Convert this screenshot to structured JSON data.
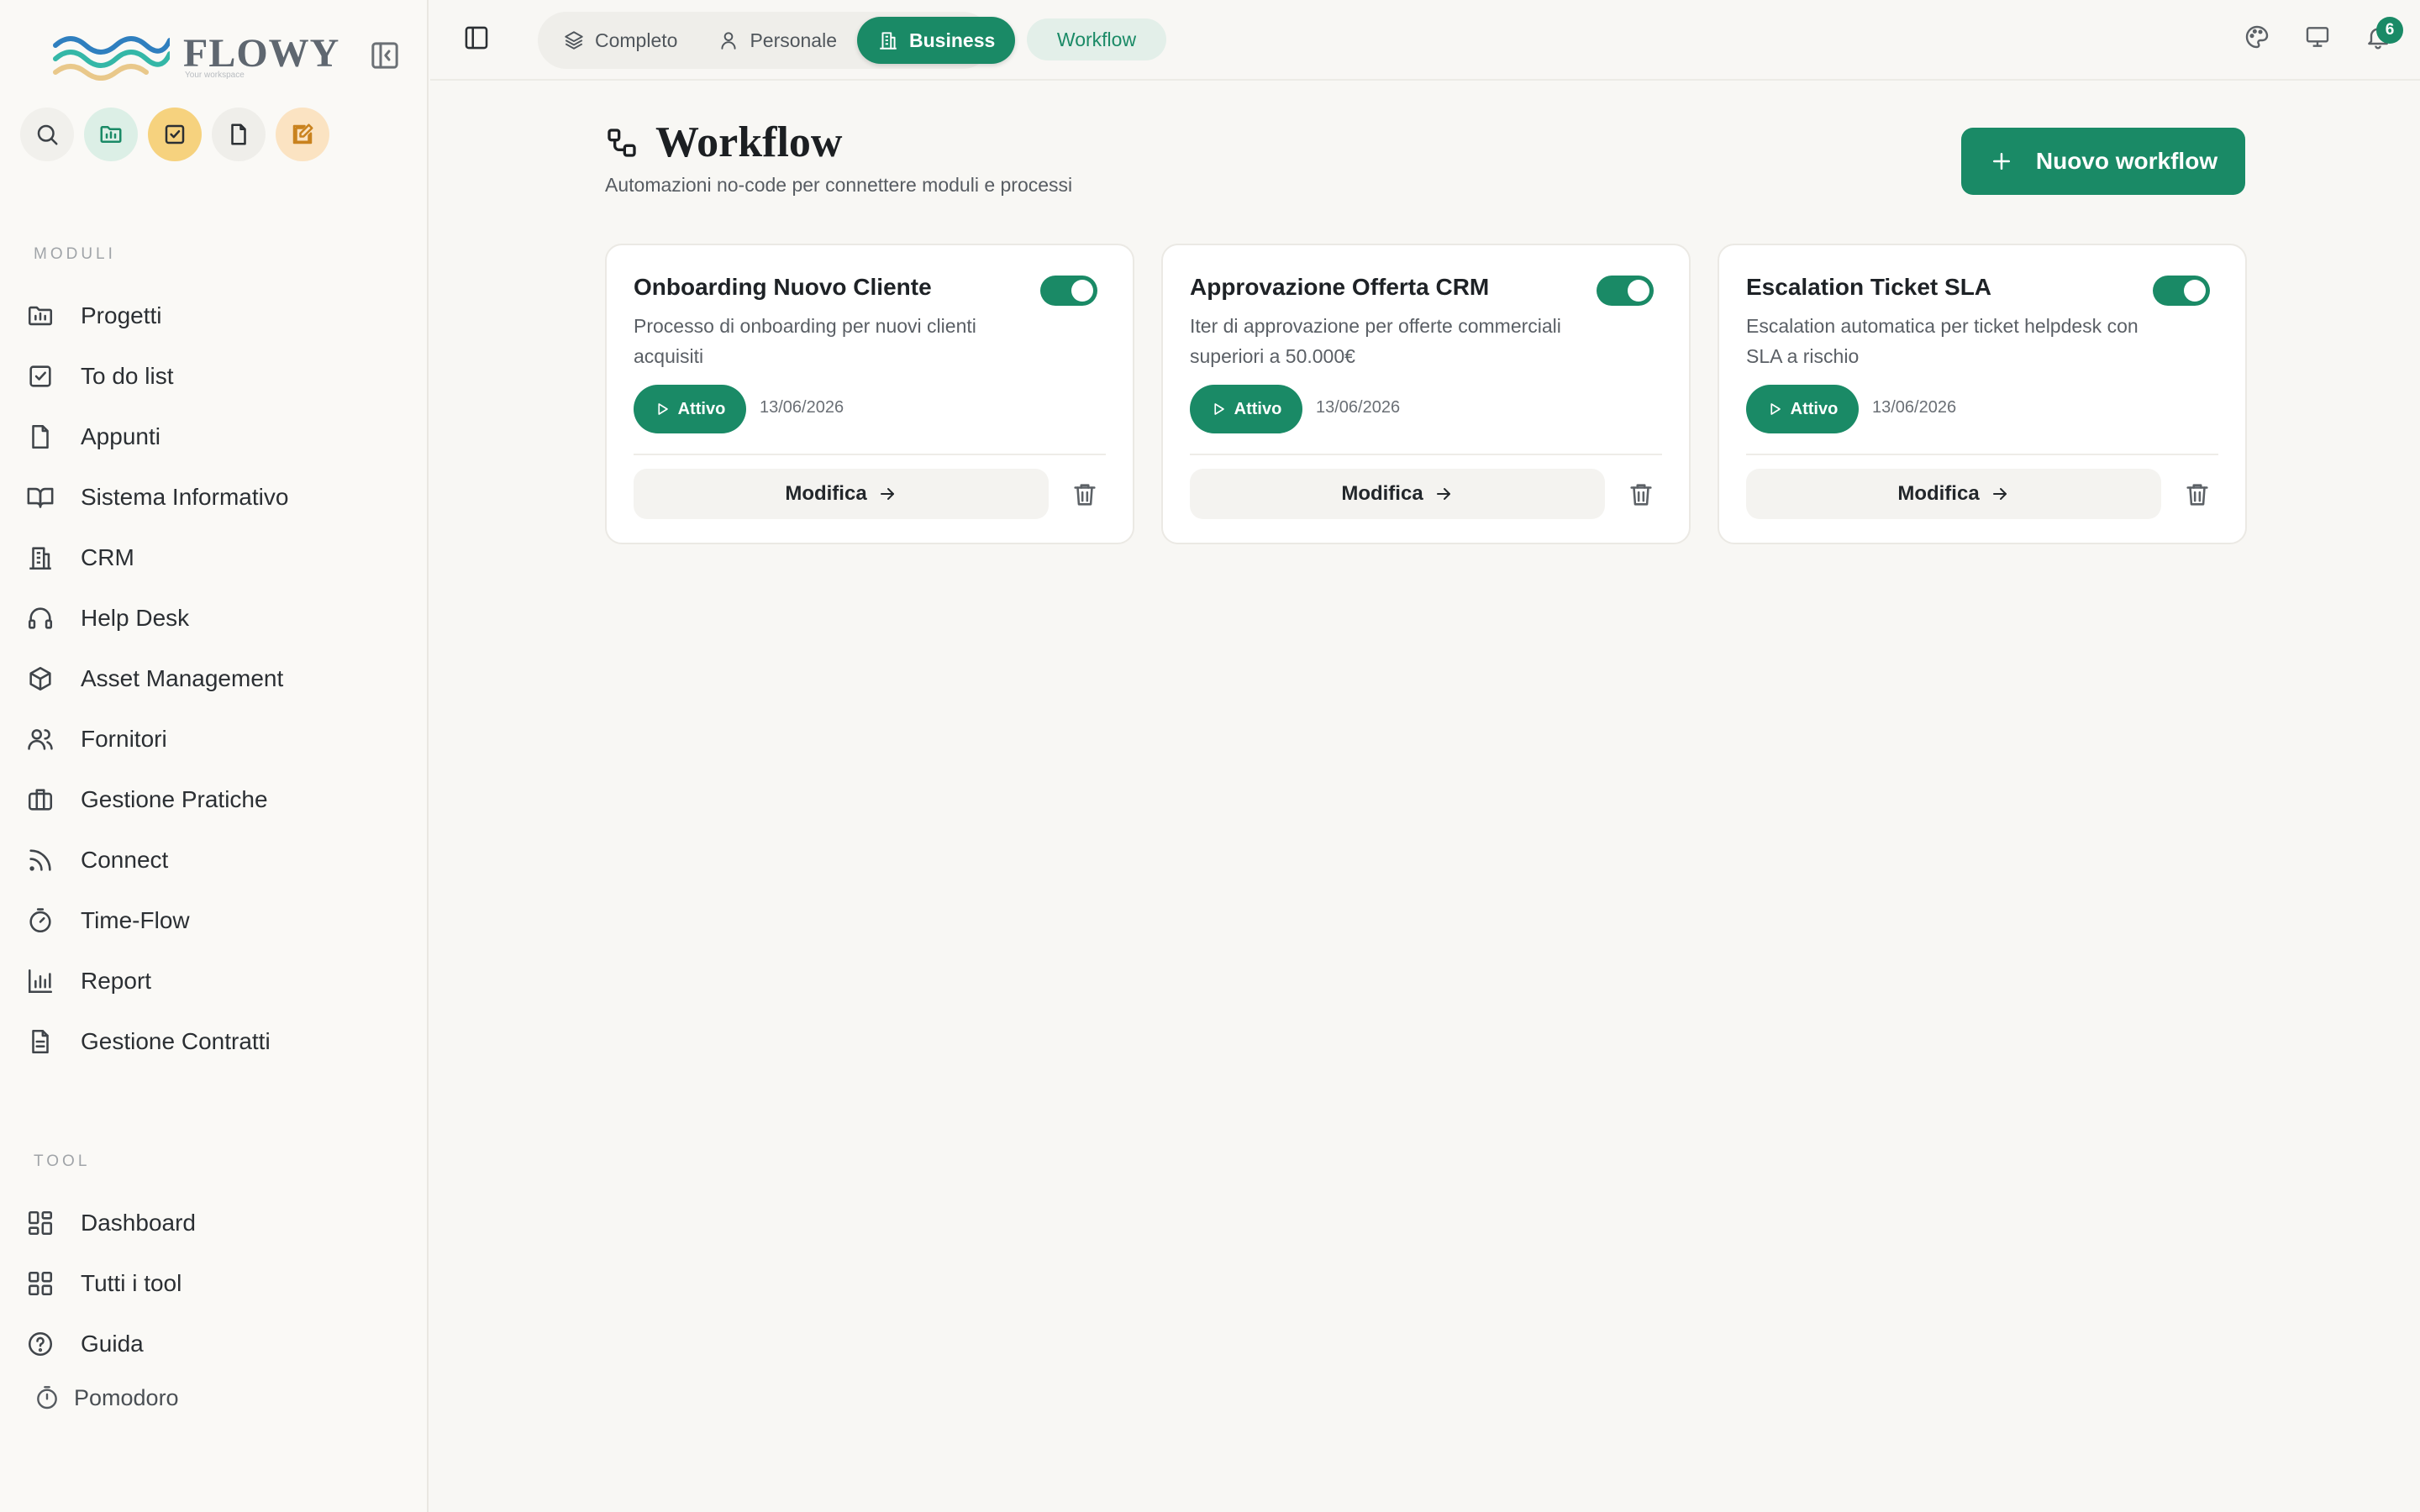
{
  "app": {
    "logo_text": "FLOWY",
    "logo_sub": "Your workspace"
  },
  "sidebar": {
    "section_modules": "MODULI",
    "modules": [
      {
        "label": "Progetti",
        "icon": "folder-chart-icon"
      },
      {
        "label": "To do list",
        "icon": "checkbox-icon"
      },
      {
        "label": "Appunti",
        "icon": "file-icon"
      },
      {
        "label": "Sistema Informativo",
        "icon": "book-open-icon"
      },
      {
        "label": "CRM",
        "icon": "building-icon"
      },
      {
        "label": "Help Desk",
        "icon": "headphones-icon"
      },
      {
        "label": "Asset Management",
        "icon": "box-icon"
      },
      {
        "label": "Fornitori",
        "icon": "users-icon"
      },
      {
        "label": "Gestione Pratiche",
        "icon": "briefcase-icon"
      },
      {
        "label": "Connect",
        "icon": "rss-icon"
      },
      {
        "label": "Time-Flow",
        "icon": "timer-icon"
      },
      {
        "label": "Report",
        "icon": "bar-chart-icon"
      },
      {
        "label": "Gestione Contratti",
        "icon": "file-text-icon"
      }
    ],
    "section_tools": "TOOL",
    "tools": [
      {
        "label": "Dashboard",
        "icon": "dashboard-icon"
      },
      {
        "label": "Tutti i tool",
        "icon": "grid-icon"
      },
      {
        "label": "Guida",
        "icon": "help-circle-icon"
      }
    ],
    "pomodoro": "Pomodoro"
  },
  "topbar": {
    "modes": [
      {
        "label": "Completo",
        "icon": "layers-icon",
        "active": false
      },
      {
        "label": "Personale",
        "icon": "user-icon",
        "active": false
      },
      {
        "label": "Business",
        "icon": "building-icon",
        "active": true
      }
    ],
    "breadcrumb": "Workflow",
    "notification_count": "6"
  },
  "page": {
    "title": "Workflow",
    "subtitle": "Automazioni no-code per connettere moduli e processi",
    "new_button": "Nuovo workflow"
  },
  "workflows": [
    {
      "title": "Onboarding Nuovo Cliente",
      "description": "Processo di onboarding per nuovi clienti acquisiti",
      "status": "Attivo",
      "date": "13/06/2026",
      "enabled": true,
      "edit_label": "Modifica"
    },
    {
      "title": "Approvazione Offerta CRM",
      "description": "Iter di approvazione per offerte commerciali superiori a 50.000€",
      "status": "Attivo",
      "date": "13/06/2026",
      "enabled": true,
      "edit_label": "Modifica"
    },
    {
      "title": "Escalation Ticket SLA",
      "description": "Escalation automatica per ticket helpdesk con SLA a rischio",
      "status": "Attivo",
      "date": "13/06/2026",
      "enabled": true,
      "edit_label": "Modifica"
    }
  ],
  "colors": {
    "accent": "#1a8a66",
    "accent_soft": "#e3efe9",
    "background": "#f8f7f4"
  }
}
